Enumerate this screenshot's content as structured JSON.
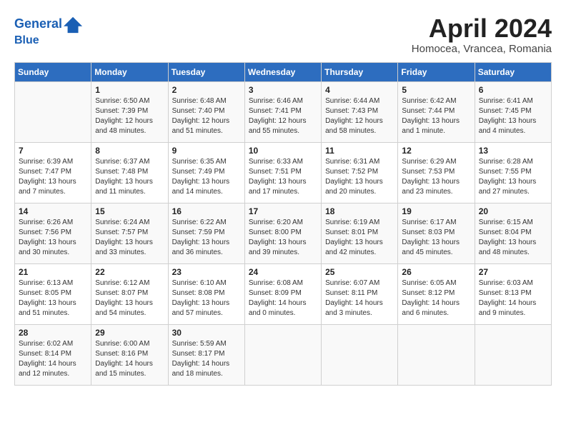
{
  "header": {
    "logo_line1": "General",
    "logo_line2": "Blue",
    "month": "April 2024",
    "location": "Homocea, Vrancea, Romania"
  },
  "days_header": [
    "Sunday",
    "Monday",
    "Tuesday",
    "Wednesday",
    "Thursday",
    "Friday",
    "Saturday"
  ],
  "weeks": [
    [
      {
        "num": "",
        "info": ""
      },
      {
        "num": "1",
        "info": "Sunrise: 6:50 AM\nSunset: 7:39 PM\nDaylight: 12 hours\nand 48 minutes."
      },
      {
        "num": "2",
        "info": "Sunrise: 6:48 AM\nSunset: 7:40 PM\nDaylight: 12 hours\nand 51 minutes."
      },
      {
        "num": "3",
        "info": "Sunrise: 6:46 AM\nSunset: 7:41 PM\nDaylight: 12 hours\nand 55 minutes."
      },
      {
        "num": "4",
        "info": "Sunrise: 6:44 AM\nSunset: 7:43 PM\nDaylight: 12 hours\nand 58 minutes."
      },
      {
        "num": "5",
        "info": "Sunrise: 6:42 AM\nSunset: 7:44 PM\nDaylight: 13 hours\nand 1 minute."
      },
      {
        "num": "6",
        "info": "Sunrise: 6:41 AM\nSunset: 7:45 PM\nDaylight: 13 hours\nand 4 minutes."
      }
    ],
    [
      {
        "num": "7",
        "info": "Sunrise: 6:39 AM\nSunset: 7:47 PM\nDaylight: 13 hours\nand 7 minutes."
      },
      {
        "num": "8",
        "info": "Sunrise: 6:37 AM\nSunset: 7:48 PM\nDaylight: 13 hours\nand 11 minutes."
      },
      {
        "num": "9",
        "info": "Sunrise: 6:35 AM\nSunset: 7:49 PM\nDaylight: 13 hours\nand 14 minutes."
      },
      {
        "num": "10",
        "info": "Sunrise: 6:33 AM\nSunset: 7:51 PM\nDaylight: 13 hours\nand 17 minutes."
      },
      {
        "num": "11",
        "info": "Sunrise: 6:31 AM\nSunset: 7:52 PM\nDaylight: 13 hours\nand 20 minutes."
      },
      {
        "num": "12",
        "info": "Sunrise: 6:29 AM\nSunset: 7:53 PM\nDaylight: 13 hours\nand 23 minutes."
      },
      {
        "num": "13",
        "info": "Sunrise: 6:28 AM\nSunset: 7:55 PM\nDaylight: 13 hours\nand 27 minutes."
      }
    ],
    [
      {
        "num": "14",
        "info": "Sunrise: 6:26 AM\nSunset: 7:56 PM\nDaylight: 13 hours\nand 30 minutes."
      },
      {
        "num": "15",
        "info": "Sunrise: 6:24 AM\nSunset: 7:57 PM\nDaylight: 13 hours\nand 33 minutes."
      },
      {
        "num": "16",
        "info": "Sunrise: 6:22 AM\nSunset: 7:59 PM\nDaylight: 13 hours\nand 36 minutes."
      },
      {
        "num": "17",
        "info": "Sunrise: 6:20 AM\nSunset: 8:00 PM\nDaylight: 13 hours\nand 39 minutes."
      },
      {
        "num": "18",
        "info": "Sunrise: 6:19 AM\nSunset: 8:01 PM\nDaylight: 13 hours\nand 42 minutes."
      },
      {
        "num": "19",
        "info": "Sunrise: 6:17 AM\nSunset: 8:03 PM\nDaylight: 13 hours\nand 45 minutes."
      },
      {
        "num": "20",
        "info": "Sunrise: 6:15 AM\nSunset: 8:04 PM\nDaylight: 13 hours\nand 48 minutes."
      }
    ],
    [
      {
        "num": "21",
        "info": "Sunrise: 6:13 AM\nSunset: 8:05 PM\nDaylight: 13 hours\nand 51 minutes."
      },
      {
        "num": "22",
        "info": "Sunrise: 6:12 AM\nSunset: 8:07 PM\nDaylight: 13 hours\nand 54 minutes."
      },
      {
        "num": "23",
        "info": "Sunrise: 6:10 AM\nSunset: 8:08 PM\nDaylight: 13 hours\nand 57 minutes."
      },
      {
        "num": "24",
        "info": "Sunrise: 6:08 AM\nSunset: 8:09 PM\nDaylight: 14 hours\nand 0 minutes."
      },
      {
        "num": "25",
        "info": "Sunrise: 6:07 AM\nSunset: 8:11 PM\nDaylight: 14 hours\nand 3 minutes."
      },
      {
        "num": "26",
        "info": "Sunrise: 6:05 AM\nSunset: 8:12 PM\nDaylight: 14 hours\nand 6 minutes."
      },
      {
        "num": "27",
        "info": "Sunrise: 6:03 AM\nSunset: 8:13 PM\nDaylight: 14 hours\nand 9 minutes."
      }
    ],
    [
      {
        "num": "28",
        "info": "Sunrise: 6:02 AM\nSunset: 8:14 PM\nDaylight: 14 hours\nand 12 minutes."
      },
      {
        "num": "29",
        "info": "Sunrise: 6:00 AM\nSunset: 8:16 PM\nDaylight: 14 hours\nand 15 minutes."
      },
      {
        "num": "30",
        "info": "Sunrise: 5:59 AM\nSunset: 8:17 PM\nDaylight: 14 hours\nand 18 minutes."
      },
      {
        "num": "",
        "info": ""
      },
      {
        "num": "",
        "info": ""
      },
      {
        "num": "",
        "info": ""
      },
      {
        "num": "",
        "info": ""
      }
    ]
  ]
}
